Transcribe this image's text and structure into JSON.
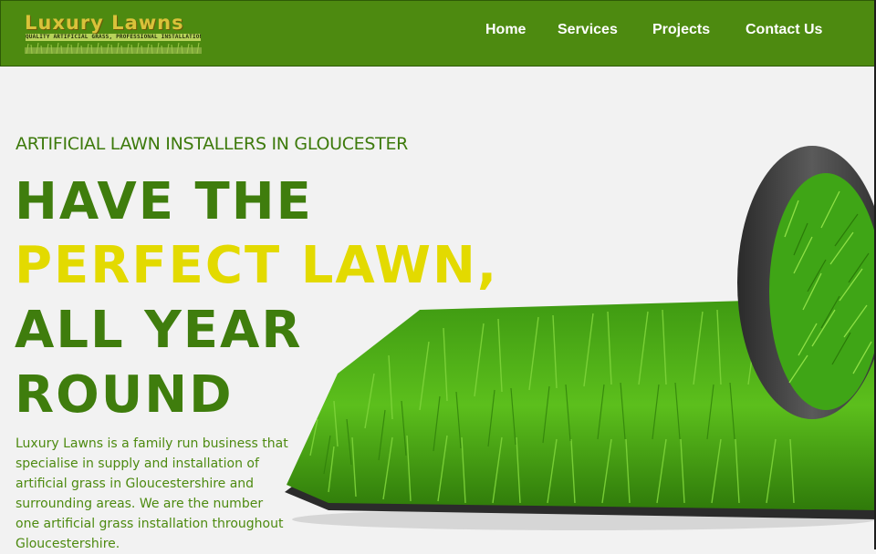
{
  "brand": {
    "name": "Luxury Lawns",
    "tagline": "QUALITY ARTIFICIAL GRASS, PROFESSIONAL INSTALLATION"
  },
  "nav": {
    "items": [
      "Home",
      "Services",
      "Projects",
      "Contact Us"
    ]
  },
  "hero": {
    "subheading": "ARTIFICIAL LAWN INSTALLERS IN GLOUCESTER",
    "headline_lines": [
      "HAVE THE",
      "PERFECT LAWN,",
      "ALL YEAR",
      "ROUND"
    ],
    "description": "Luxury Lawns is a family run business that specialise in supply and installation of artificial grass in Gloucestershire and surrounding areas. We are the number one artificial grass installation throughout Gloucestershire."
  },
  "colors": {
    "header_bg": "#4d8a10",
    "headline_green": "#3f7d0d",
    "headline_yellow": "#e3da00",
    "page_bg": "#f2f2f2"
  }
}
